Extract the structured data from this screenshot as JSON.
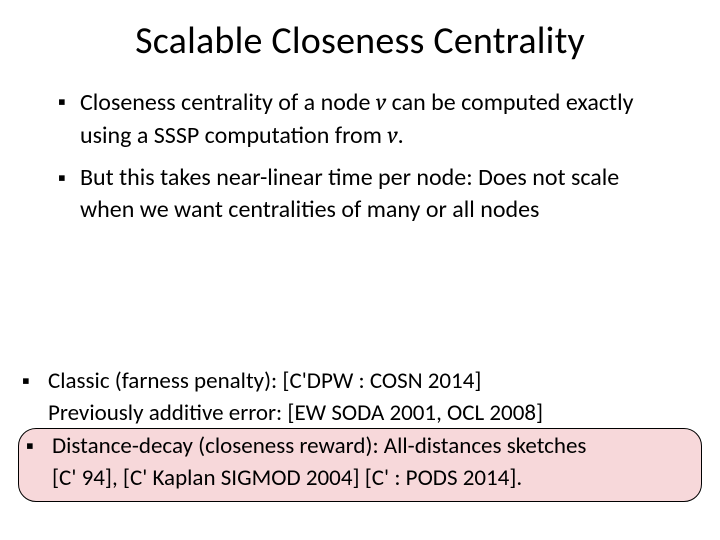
{
  "title": "Scalable Closeness Centrality",
  "top": {
    "b1_a": "Closeness centrality of a node ",
    "b1_v1": "v",
    "b1_b": "  can be computed exactly using a SSSP computation from ",
    "b1_v2": "v",
    "b1_c": ".",
    "b2": "But this takes near-linear time per node: Does not scale when we want centralities of many or all nodes"
  },
  "bottom": {
    "b1": "Classic (farness penalty):  [C'DPW : COSN 2014]",
    "b1_sub": "Previously additive error:  [EW SODA 2001, OCL 2008]",
    "b2_line1": "Distance-decay (closeness reward): All-distances sketches",
    "b2_line2": "[C' 94], [C' Kaplan SIGMOD 2004] [C' : PODS 2014]."
  }
}
